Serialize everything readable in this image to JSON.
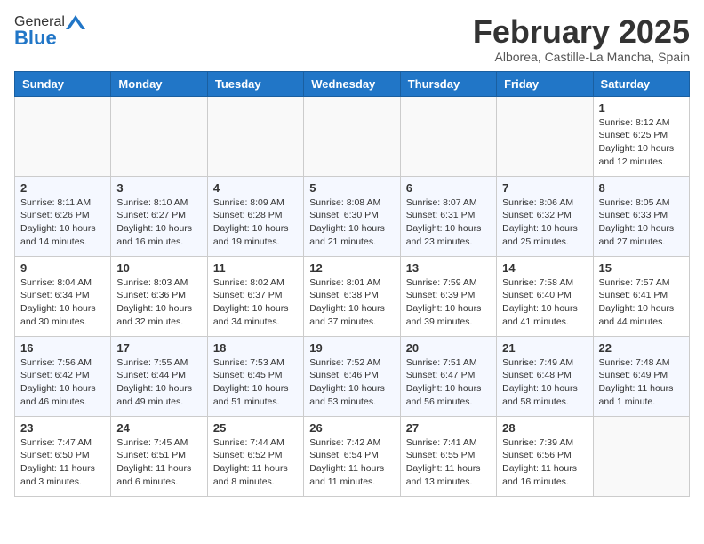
{
  "header": {
    "logo_general": "General",
    "logo_blue": "Blue",
    "month_title": "February 2025",
    "location": "Alborea, Castille-La Mancha, Spain"
  },
  "calendar": {
    "weekdays": [
      "Sunday",
      "Monday",
      "Tuesday",
      "Wednesday",
      "Thursday",
      "Friday",
      "Saturday"
    ],
    "weeks": [
      [
        {
          "day": "",
          "info": ""
        },
        {
          "day": "",
          "info": ""
        },
        {
          "day": "",
          "info": ""
        },
        {
          "day": "",
          "info": ""
        },
        {
          "day": "",
          "info": ""
        },
        {
          "day": "",
          "info": ""
        },
        {
          "day": "1",
          "info": "Sunrise: 8:12 AM\nSunset: 6:25 PM\nDaylight: 10 hours and 12 minutes."
        }
      ],
      [
        {
          "day": "2",
          "info": "Sunrise: 8:11 AM\nSunset: 6:26 PM\nDaylight: 10 hours and 14 minutes."
        },
        {
          "day": "3",
          "info": "Sunrise: 8:10 AM\nSunset: 6:27 PM\nDaylight: 10 hours and 16 minutes."
        },
        {
          "day": "4",
          "info": "Sunrise: 8:09 AM\nSunset: 6:28 PM\nDaylight: 10 hours and 19 minutes."
        },
        {
          "day": "5",
          "info": "Sunrise: 8:08 AM\nSunset: 6:30 PM\nDaylight: 10 hours and 21 minutes."
        },
        {
          "day": "6",
          "info": "Sunrise: 8:07 AM\nSunset: 6:31 PM\nDaylight: 10 hours and 23 minutes."
        },
        {
          "day": "7",
          "info": "Sunrise: 8:06 AM\nSunset: 6:32 PM\nDaylight: 10 hours and 25 minutes."
        },
        {
          "day": "8",
          "info": "Sunrise: 8:05 AM\nSunset: 6:33 PM\nDaylight: 10 hours and 27 minutes."
        }
      ],
      [
        {
          "day": "9",
          "info": "Sunrise: 8:04 AM\nSunset: 6:34 PM\nDaylight: 10 hours and 30 minutes."
        },
        {
          "day": "10",
          "info": "Sunrise: 8:03 AM\nSunset: 6:36 PM\nDaylight: 10 hours and 32 minutes."
        },
        {
          "day": "11",
          "info": "Sunrise: 8:02 AM\nSunset: 6:37 PM\nDaylight: 10 hours and 34 minutes."
        },
        {
          "day": "12",
          "info": "Sunrise: 8:01 AM\nSunset: 6:38 PM\nDaylight: 10 hours and 37 minutes."
        },
        {
          "day": "13",
          "info": "Sunrise: 7:59 AM\nSunset: 6:39 PM\nDaylight: 10 hours and 39 minutes."
        },
        {
          "day": "14",
          "info": "Sunrise: 7:58 AM\nSunset: 6:40 PM\nDaylight: 10 hours and 41 minutes."
        },
        {
          "day": "15",
          "info": "Sunrise: 7:57 AM\nSunset: 6:41 PM\nDaylight: 10 hours and 44 minutes."
        }
      ],
      [
        {
          "day": "16",
          "info": "Sunrise: 7:56 AM\nSunset: 6:42 PM\nDaylight: 10 hours and 46 minutes."
        },
        {
          "day": "17",
          "info": "Sunrise: 7:55 AM\nSunset: 6:44 PM\nDaylight: 10 hours and 49 minutes."
        },
        {
          "day": "18",
          "info": "Sunrise: 7:53 AM\nSunset: 6:45 PM\nDaylight: 10 hours and 51 minutes."
        },
        {
          "day": "19",
          "info": "Sunrise: 7:52 AM\nSunset: 6:46 PM\nDaylight: 10 hours and 53 minutes."
        },
        {
          "day": "20",
          "info": "Sunrise: 7:51 AM\nSunset: 6:47 PM\nDaylight: 10 hours and 56 minutes."
        },
        {
          "day": "21",
          "info": "Sunrise: 7:49 AM\nSunset: 6:48 PM\nDaylight: 10 hours and 58 minutes."
        },
        {
          "day": "22",
          "info": "Sunrise: 7:48 AM\nSunset: 6:49 PM\nDaylight: 11 hours and 1 minute."
        }
      ],
      [
        {
          "day": "23",
          "info": "Sunrise: 7:47 AM\nSunset: 6:50 PM\nDaylight: 11 hours and 3 minutes."
        },
        {
          "day": "24",
          "info": "Sunrise: 7:45 AM\nSunset: 6:51 PM\nDaylight: 11 hours and 6 minutes."
        },
        {
          "day": "25",
          "info": "Sunrise: 7:44 AM\nSunset: 6:52 PM\nDaylight: 11 hours and 8 minutes."
        },
        {
          "day": "26",
          "info": "Sunrise: 7:42 AM\nSunset: 6:54 PM\nDaylight: 11 hours and 11 minutes."
        },
        {
          "day": "27",
          "info": "Sunrise: 7:41 AM\nSunset: 6:55 PM\nDaylight: 11 hours and 13 minutes."
        },
        {
          "day": "28",
          "info": "Sunrise: 7:39 AM\nSunset: 6:56 PM\nDaylight: 11 hours and 16 minutes."
        },
        {
          "day": "",
          "info": ""
        }
      ]
    ]
  }
}
